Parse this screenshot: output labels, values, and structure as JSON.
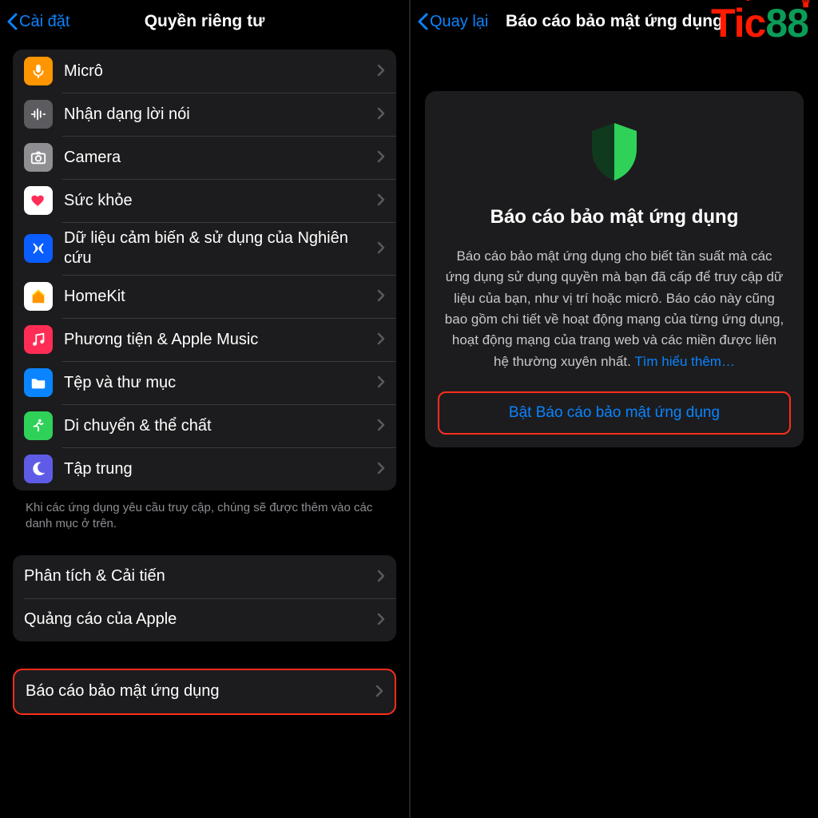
{
  "watermark": {
    "text1": "Tic",
    "text2": "88"
  },
  "left": {
    "back": "Cài đặt",
    "title": "Quyền riêng tư",
    "items": [
      {
        "name": "micro",
        "label": "Micrô",
        "iconBg": "#ff9500",
        "glyph": "mic"
      },
      {
        "name": "speech",
        "label": "Nhận dạng lời nói",
        "iconBg": "#5b5b60",
        "glyph": "wave"
      },
      {
        "name": "camera",
        "label": "Camera",
        "iconBg": "#8e8e93",
        "glyph": "camera"
      },
      {
        "name": "health",
        "label": "Sức khỏe",
        "iconBg": "#ffffff",
        "glyph": "heart"
      },
      {
        "name": "sensor",
        "label": "Dữ liệu cảm biến & sử dụng của Nghiên cứu",
        "iconBg": "#0a5dff",
        "glyph": "sensor"
      },
      {
        "name": "homekit",
        "label": "HomeKit",
        "iconBg": "#ffffff",
        "glyph": "home"
      },
      {
        "name": "media",
        "label": "Phương tiện & Apple Music",
        "iconBg": "#ff2d55",
        "glyph": "music"
      },
      {
        "name": "files",
        "label": "Tệp và thư mục",
        "iconBg": "#0a84ff",
        "glyph": "folder"
      },
      {
        "name": "motion",
        "label": "Di chuyển & thể chất",
        "iconBg": "#30d158",
        "glyph": "run"
      },
      {
        "name": "focus",
        "label": "Tập trung",
        "iconBg": "#5e5ce6",
        "glyph": "moon"
      }
    ],
    "footerNote": "Khi các ứng dụng yêu cầu truy cập, chúng sẽ được thêm vào các danh mục ở trên.",
    "group2": [
      {
        "name": "analytics",
        "label": "Phân tích & Cải tiến"
      },
      {
        "name": "ads",
        "label": "Quảng cáo của Apple"
      }
    ],
    "group3": [
      {
        "name": "privacy-report",
        "label": "Báo cáo bảo mật ứng dụng",
        "highlight": true
      }
    ]
  },
  "right": {
    "back": "Quay lại",
    "title": "Báo cáo bảo mật ứng dụng",
    "heading": "Báo cáo bảo mật ứng dụng",
    "body": "Báo cáo bảo mật ứng dụng cho biết tần suất mà các ứng dụng sử dụng quyền mà bạn đã cấp để truy cập dữ liệu của bạn, như vị trí hoặc micrô. Báo cáo này cũng bao gồm chi tiết về hoạt động mạng của từng ứng dụng, hoạt động mạng của trang web và các miền được liên hệ thường xuyên nhất. ",
    "learnMore": "Tìm hiểu thêm…",
    "enable": "Bật Báo cáo bảo mật ứng dụng"
  },
  "colors": {
    "link": "#0a84ff",
    "highlight": "#ff2d1a",
    "shield": "#30d158"
  }
}
